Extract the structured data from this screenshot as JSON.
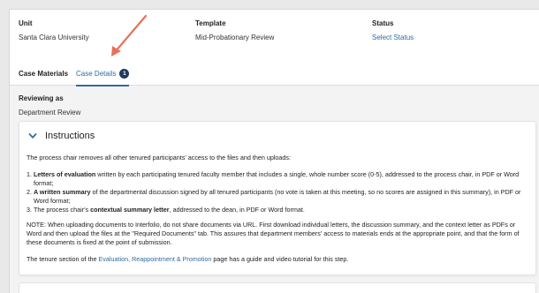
{
  "header": {
    "unit": {
      "label": "Unit",
      "value": "Santa Clara University"
    },
    "template": {
      "label": "Template",
      "value": "Mid-Probationary Review"
    },
    "status": {
      "label": "Status",
      "value": "Select Status"
    }
  },
  "tabs": [
    {
      "label": "Case Materials",
      "active": false
    },
    {
      "label": "Case Details",
      "active": true,
      "badge": "1"
    }
  ],
  "reviewing": {
    "label": "Reviewing as",
    "value": "Department Review"
  },
  "instructions": {
    "title": "Instructions",
    "intro": "The process chair removes all other tenured participants' access to the files and then uploads:",
    "items": [
      {
        "num": "1.",
        "bold": "Letters of evaluation",
        "text": " written by each participating tenured faculty member that includes a single, whole number score (0-5), addressed to the process chair, in PDF or Word format;"
      },
      {
        "num": "2.",
        "bold": "A written summary",
        "text": " of the departmental discussion signed by all tenured participants (no vote is taken at this meeting, so no scores are assigned in this summary), in PDF or Word format;"
      },
      {
        "num": "3.",
        "pre": "The process chair's ",
        "bold": "contextual summary letter",
        "text": ", addressed to the dean, in PDF or Word format."
      }
    ],
    "note": "NOTE: When uploading documents to Interfolio, do not share documents via URL. First download individual letters, the discussion summary, and the context letter as PDFs or Word and then upload the files at the \"Required Documents\" tab. This assures that department members' access to materials ends at the appropriate point, and that the form of these documents is fixed at the point of submission.",
    "footer_pre": "The tenure section of the ",
    "footer_link": "Evaluation, Reappointment & Promotion",
    "footer_post": " page has a guide and video tutorial for this step."
  },
  "colors": {
    "accent": "#2d6ca2",
    "badge": "#1f3a5f",
    "arrow": "#e5735b"
  }
}
